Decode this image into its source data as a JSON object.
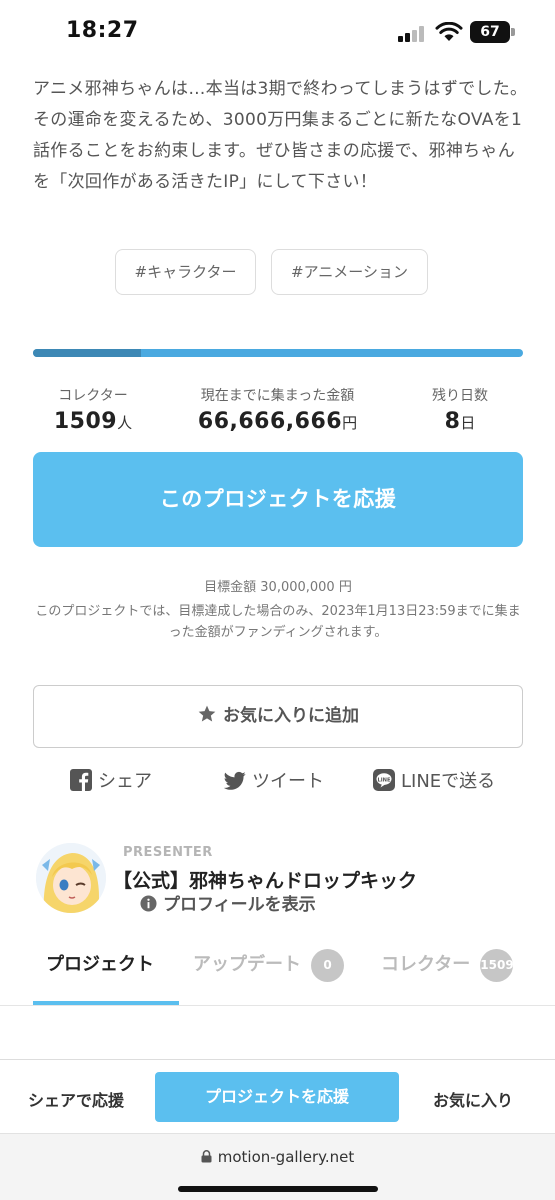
{
  "status_bar": {
    "time": "18:27",
    "battery": "67",
    "icons": [
      "signal-icon",
      "wifi-icon",
      "battery-icon"
    ]
  },
  "project": {
    "description": "アニメ邪神ちゃんは…本当は3期で終わってしまうはずでした。その運命を変えるため、3000万円集まるごとに新たなOVAを1話作ることをお約束します。ぜひ皆さまの応援で、邪神ちゃんを「次回作がある活きたIP」にして下さい！",
    "tags": [
      "#キャラクター",
      "#アニメーション"
    ],
    "progress_fraction": 0.22
  },
  "stats": {
    "collectors_label": "コレクター",
    "collectors_value": "1509",
    "collectors_unit": "人",
    "amount_label": "現在までに集まった金額",
    "amount_value": "66,666,666",
    "amount_unit": "円",
    "days_label": "残り日数",
    "days_value": "8",
    "days_unit": "日"
  },
  "support_button": "このプロジェクトを応援",
  "goal": {
    "amount": "目標金額 30,000,000 円",
    "note": "このプロジェクトでは、目標達成した場合のみ、2023年1月13日23:59までに集まった金額がファンディングされます。"
  },
  "favorite_button": "お気に入りに追加",
  "share": {
    "facebook": "シェア",
    "twitter": "ツイート",
    "line": "LINEで送る"
  },
  "presenter": {
    "caption": "PRESENTER",
    "name": "【公式】邪神ちゃんドロップキック",
    "profile_link": "プロフィールを表示"
  },
  "tabs": {
    "project": "プロジェクト",
    "updates": "アップデート",
    "updates_count": "0",
    "collectors": "コレクター",
    "collectors_count": "1509"
  },
  "bottom_bar": {
    "share": "シェアで応援",
    "support": "プロジェクトを応援",
    "favorite": "お気に入り"
  },
  "browser": {
    "url": "motion-gallery.net"
  },
  "colors": {
    "accent": "#5bbfef",
    "progress_track": "#4aa9e0",
    "progress_fill": "#3d88b5"
  }
}
